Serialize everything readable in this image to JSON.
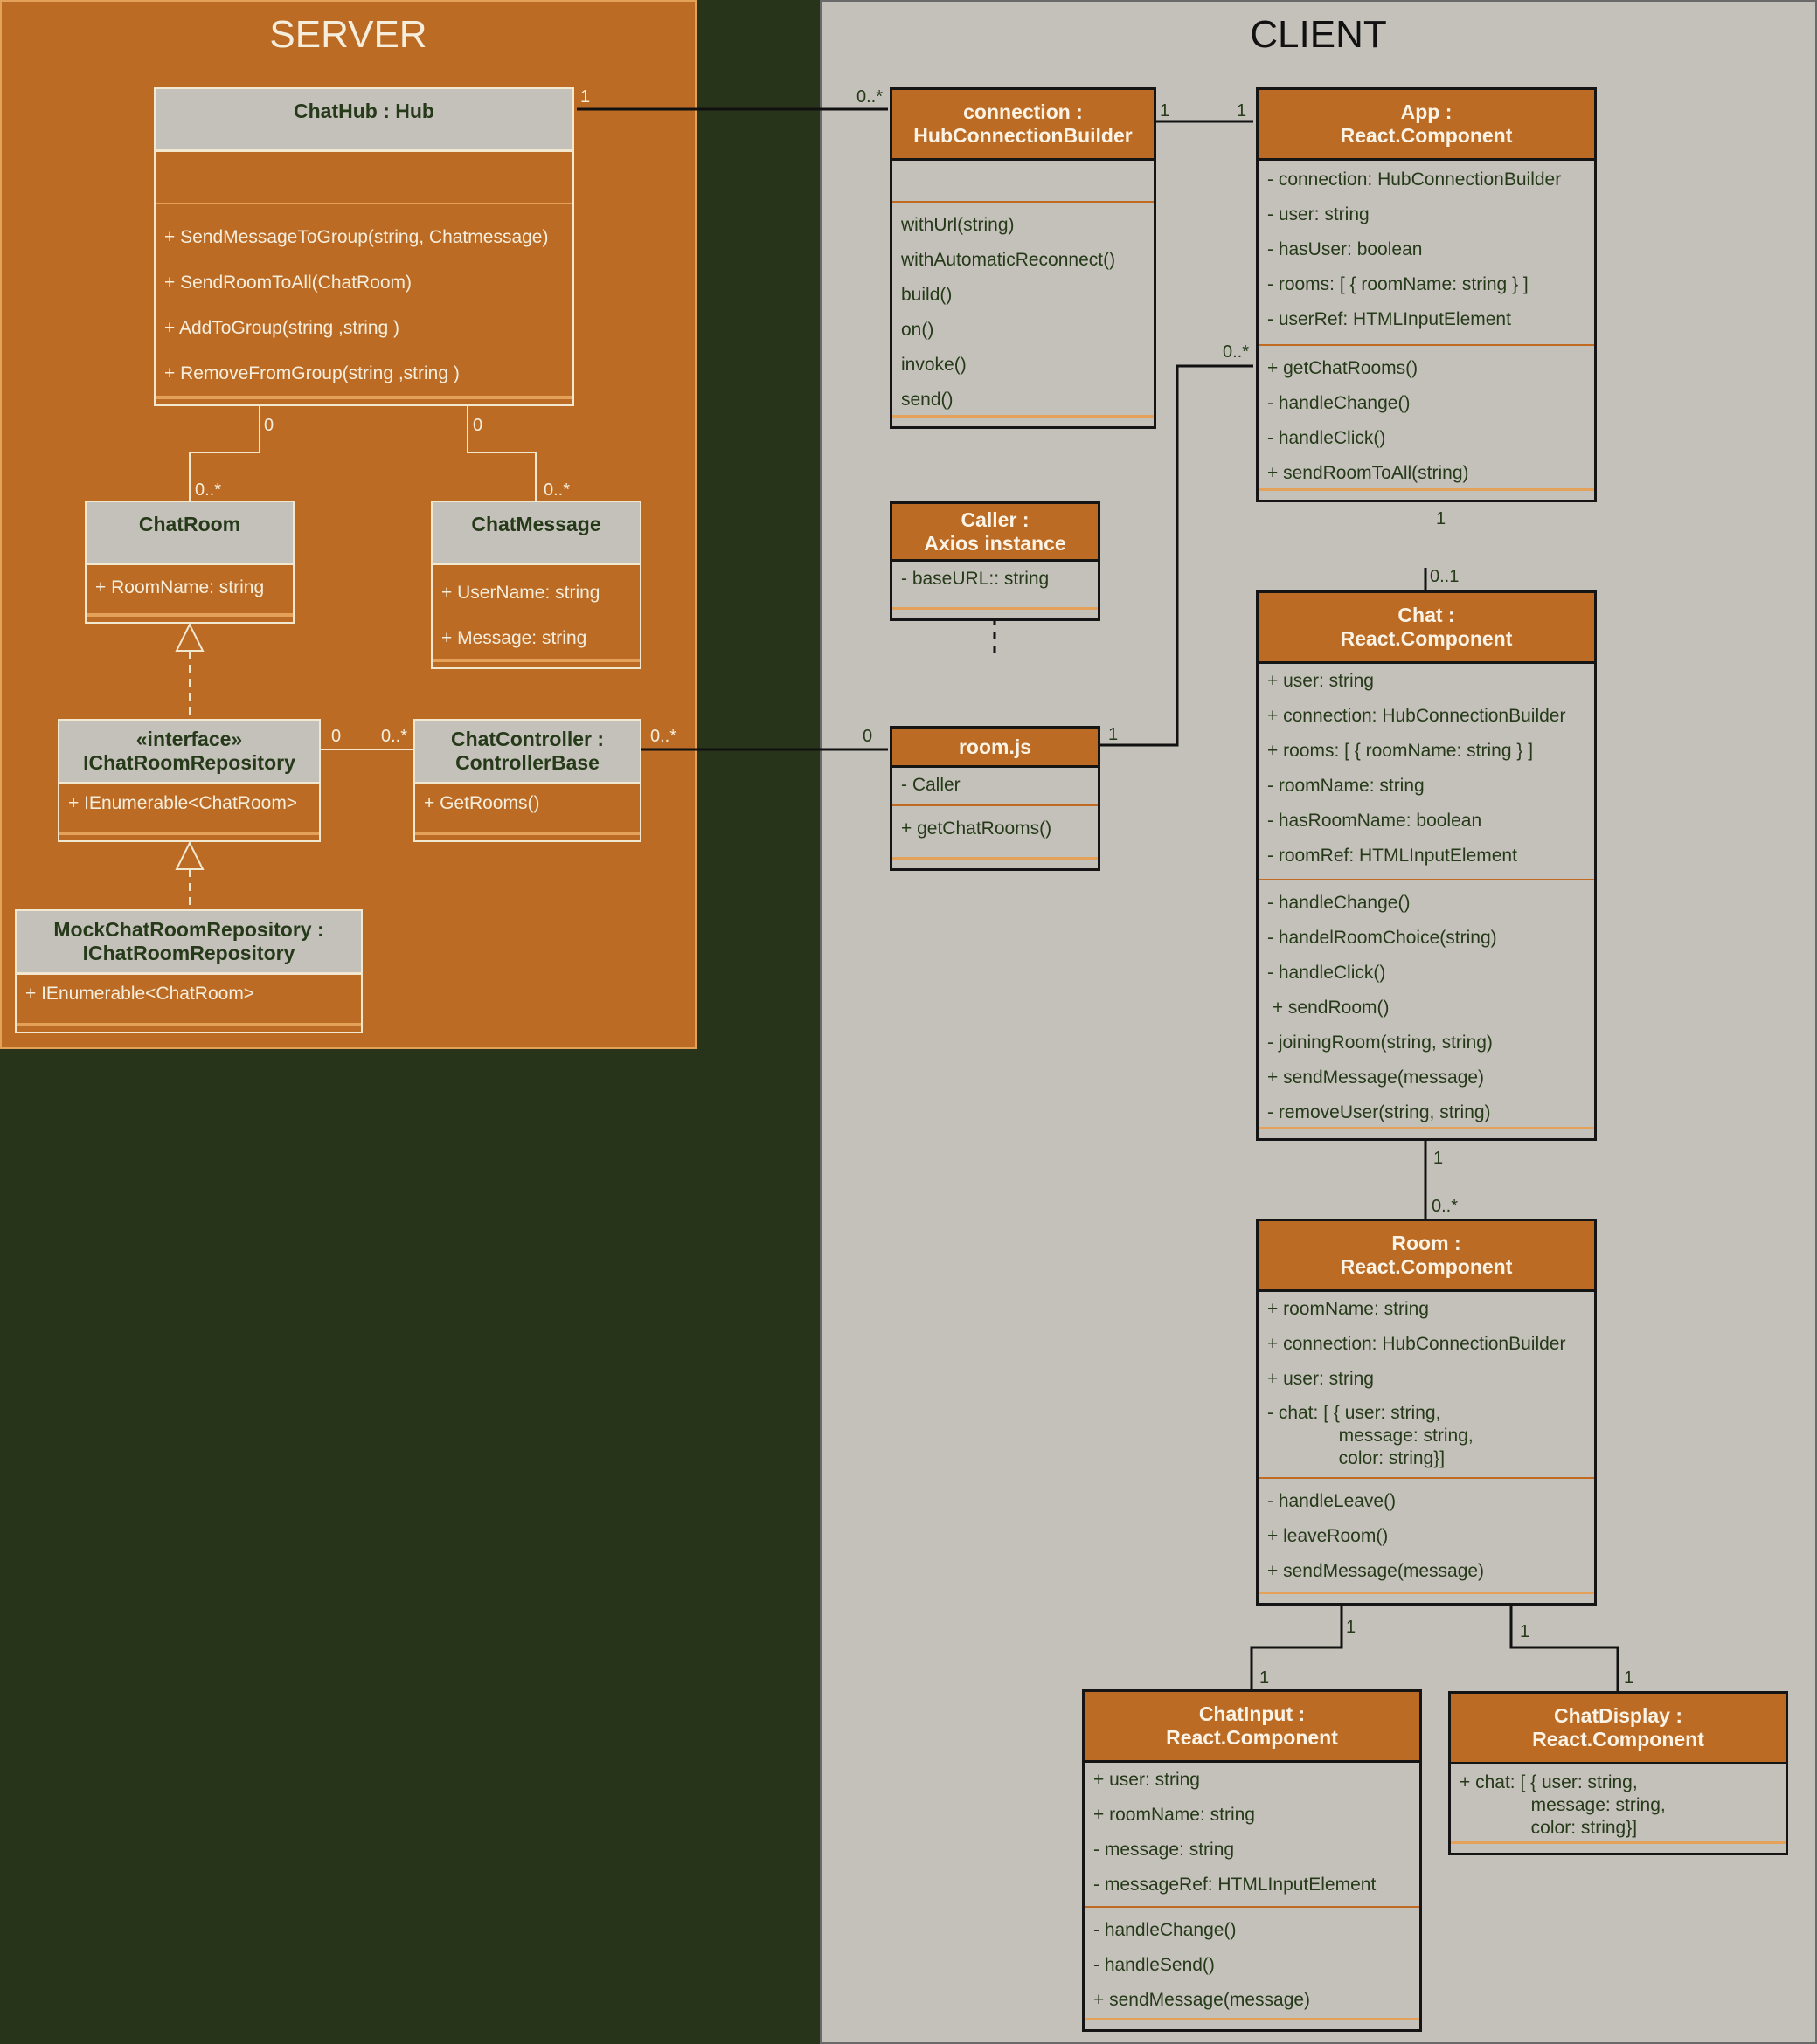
{
  "server": {
    "title": "SERVER",
    "classes": {
      "chathub": {
        "name": "ChatHub : Hub",
        "attributes": [],
        "methods": [
          "+ SendMessageToGroup(string, Chatmessage)",
          "+ SendRoomToAll(ChatRoom)",
          "+ AddToGroup(string ,string )",
          "+ RemoveFromGroup(string ,string )"
        ]
      },
      "chatroom": {
        "name": "ChatRoom",
        "attributes": [
          "+ RoomName: string"
        ]
      },
      "chatmessage": {
        "name": "ChatMessage",
        "attributes": [
          "+ UserName: string",
          "+ Message: string"
        ]
      },
      "ichatroomrepository": {
        "stereotype": "«interface»",
        "name": "IChatRoomRepository",
        "attributes": [
          "+ IEnumerable<ChatRoom>"
        ]
      },
      "chatcontroller": {
        "name_line1": "ChatController :",
        "name_line2": "ControllerBase",
        "attributes": [
          "+ GetRooms()"
        ]
      },
      "mockchatroomrepository": {
        "name_line1": "MockChatRoomRepository :",
        "name_line2": "IChatRoomRepository",
        "attributes": [
          "+ IEnumerable<ChatRoom>"
        ]
      }
    }
  },
  "client": {
    "title": "CLIENT",
    "classes": {
      "connection": {
        "name_line1": "connection :",
        "name_line2": "HubConnectionBuilder",
        "attributes": [],
        "methods": [
          "withUrl(string)",
          "withAutomaticReconnect()",
          "build()",
          "on()",
          "invoke()",
          "send()"
        ]
      },
      "app": {
        "name_line1": "App :",
        "name_line2": "React.Component",
        "attributes": [
          "- connection: HubConnectionBuilder",
          "- user: string",
          "- hasUser: boolean",
          "- rooms: [ { roomName: string } ]",
          "- userRef: HTMLInputElement"
        ],
        "methods": [
          "+ getChatRooms()",
          "- handleChange()",
          "- handleClick()",
          "+ sendRoomToAll(string)"
        ]
      },
      "caller": {
        "name_line1": "Caller :",
        "name_line2": "Axios instance",
        "attributes": [
          "- baseURL:: string"
        ]
      },
      "roomjs": {
        "name": "room.js",
        "attributes": [
          "- Caller"
        ],
        "methods": [
          "+ getChatRooms()"
        ]
      },
      "chat": {
        "name_line1": "Chat  :",
        "name_line2": "React.Component",
        "attributes": [
          "+ user: string",
          "+ connection: HubConnectionBuilder",
          "+ rooms: [ { roomName: string } ]",
          "- roomName: string",
          "- hasRoomName: boolean",
          "- roomRef: HTMLInputElement"
        ],
        "methods": [
          "- handleChange()",
          "- handelRoomChoice(string)",
          "- handleClick()",
          " + sendRoom()",
          "- joiningRoom(string, string)",
          "+ sendMessage(message)",
          "- removeUser(string, string)"
        ]
      },
      "room": {
        "name_line1": "Room  :",
        "name_line2": "React.Component",
        "attributes": [
          "+ roomName: string",
          "+ connection: HubConnectionBuilder",
          "+ user: string",
          "- chat: [ { user: string,",
          "              message: string,",
          "              color: string}]"
        ],
        "methods": [
          "- handleLeave()",
          "+ leaveRoom()",
          "+ sendMessage(message)"
        ]
      },
      "chatinput": {
        "name_line1": "ChatInput  :",
        "name_line2": "React.Component",
        "attributes": [
          "+ user: string",
          "+ roomName: string",
          "- message: string",
          "- messageRef: HTMLInputElement"
        ],
        "methods": [
          "- handleChange()",
          "- handleSend()",
          "+ sendMessage(message)"
        ]
      },
      "chatdisplay": {
        "name_line1": "ChatDisplay  :",
        "name_line2": "React.Component",
        "attributes": [
          "+ chat: [ { user: string,",
          "              message: string,",
          "              color: string}]"
        ]
      }
    }
  },
  "relations": [
    {
      "id": "chathub-connection",
      "from": "ChatHub",
      "to": "connection",
      "from_mult": "1",
      "to_mult": "0..*"
    },
    {
      "id": "chathub-chatroom",
      "from": "ChatHub",
      "to": "ChatRoom",
      "from_mult": "0",
      "to_mult": "0..*"
    },
    {
      "id": "chathub-chatmessage",
      "from": "ChatHub",
      "to": "ChatMessage",
      "from_mult": "0",
      "to_mult": "0..*"
    },
    {
      "id": "irepo-controller",
      "from": "IChatRoomRepository",
      "to": "ChatController",
      "from_mult": "0",
      "to_mult": "0..*"
    },
    {
      "id": "controller-roomjs",
      "from": "ChatController",
      "to": "room.js",
      "from_mult": "0..*",
      "to_mult": "0"
    },
    {
      "id": "connection-app",
      "from": "connection",
      "to": "App",
      "from_mult": "1",
      "to_mult": "1"
    },
    {
      "id": "roomjs-app",
      "from": "room.js",
      "to": "App",
      "from_mult": "1",
      "to_mult": "0..*"
    },
    {
      "id": "app-chat",
      "from": "App",
      "to": "Chat",
      "from_mult": "1",
      "to_mult": "0..1"
    },
    {
      "id": "chat-room",
      "from": "Chat",
      "to": "Room",
      "from_mult": "1",
      "to_mult": "0..*"
    },
    {
      "id": "room-chatinput",
      "from": "Room",
      "to": "ChatInput",
      "from_mult": "1",
      "to_mult": "1"
    },
    {
      "id": "room-chatdisplay",
      "from": "Room",
      "to": "ChatDisplay",
      "from_mult": "1",
      "to_mult": "1"
    },
    {
      "id": "irepo-realizes-chatroom",
      "type": "realization",
      "from": "IChatRoomRepository",
      "to": "ChatRoom"
    },
    {
      "id": "mock-realizes-irepo",
      "type": "realization",
      "from": "MockChatRoomRepository",
      "to": "IChatRoomRepository"
    },
    {
      "id": "roomjs-realizes-caller",
      "type": "realization",
      "from": "room.js",
      "to": "Caller"
    }
  ],
  "colors": {
    "background": "#283419",
    "orange": "#BC6B25",
    "gray": "#C4C1BA",
    "cream": "#F2E8CF",
    "separator": "#E3A15A"
  }
}
